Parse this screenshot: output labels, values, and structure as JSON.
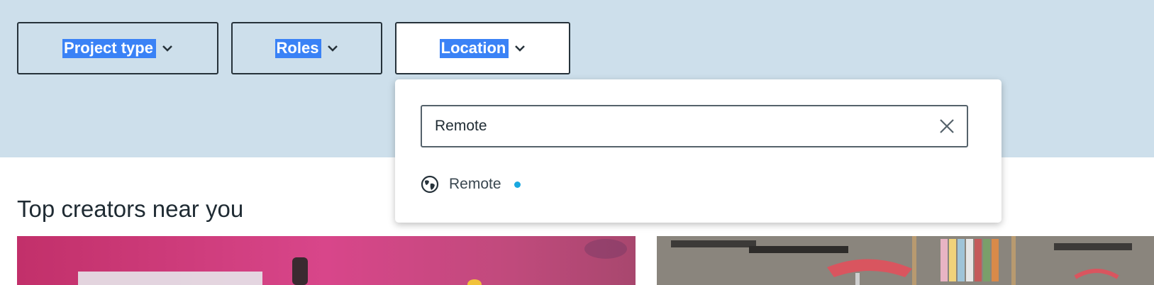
{
  "filters": {
    "project_type": "Project type",
    "roles": "Roles",
    "location": "Location"
  },
  "location_dropdown": {
    "search_value": "Remote",
    "suggestions": [
      {
        "label": "Remote",
        "icon": "globe-icon"
      }
    ]
  },
  "section": {
    "title": "Top creators near you"
  },
  "colors": {
    "band": "#cddfeb",
    "text": "#1f2b33",
    "highlight": "#3a82f6",
    "dot": "#1aa8e0"
  }
}
